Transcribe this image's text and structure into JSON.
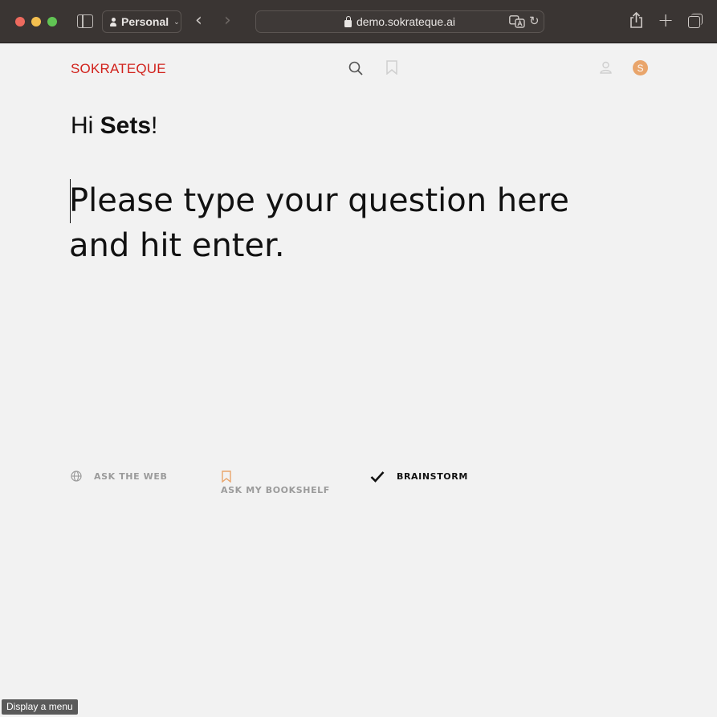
{
  "browser": {
    "profile_label": "Personal",
    "url": "demo.sokrateque.ai"
  },
  "header": {
    "logo": "SOKRATEQUE",
    "avatar_initial": "S"
  },
  "greeting": {
    "prefix": "Hi ",
    "name": "Sets",
    "suffix": "!"
  },
  "question": {
    "placeholder": "Please type your question here and hit enter.",
    "value": ""
  },
  "modes": {
    "ask_web": "ASK THE WEB",
    "ask_bookshelf": "ASK MY BOOKSHELF",
    "brainstorm": "BRAINSTORM",
    "selected": "BRAINSTORM"
  },
  "tooltip": "Display a menu",
  "colors": {
    "brand_red": "#d1211b",
    "avatar_orange": "#e9a56b",
    "bookmark_orange": "#e9a56b"
  }
}
